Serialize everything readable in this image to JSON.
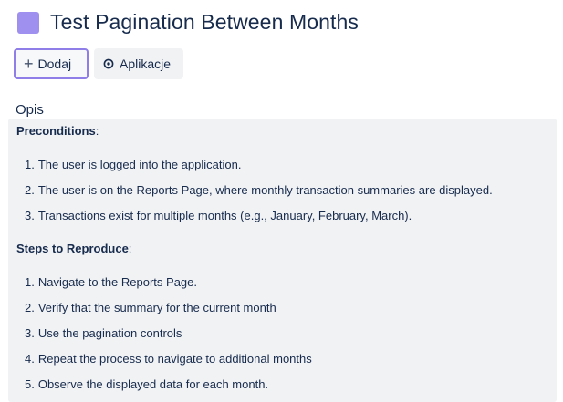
{
  "issue": {
    "title": "Test Pagination Between Months",
    "type_color": "#9f8fef"
  },
  "toolbar": {
    "add_label": "Dodaj",
    "apps_label": "Aplikacje",
    "accent_color": "#8f7ee7"
  },
  "description": {
    "label": "Opis",
    "preconditions_heading": "Preconditions",
    "heading_suffix": ":",
    "preconditions": [
      {
        "num": "1.",
        "text": "The user is logged into the application."
      },
      {
        "num": "2.",
        "text": "The user is on the Reports Page, where monthly transaction summaries are displayed."
      },
      {
        "num": "3.",
        "text": "Transactions exist for multiple months (e.g., January, February, March)."
      }
    ],
    "steps_heading": "Steps to Reproduce",
    "steps": [
      {
        "num": "1.",
        "text": "Navigate to the Reports Page."
      },
      {
        "num": "2.",
        "text": "Verify that the summary for the current month"
      },
      {
        "num": "3.",
        "text": "Use the pagination controls"
      },
      {
        "num": "4.",
        "text": "Repeat the process to navigate to additional months"
      },
      {
        "num": "5.",
        "text": "Observe the displayed data for each month."
      }
    ]
  }
}
